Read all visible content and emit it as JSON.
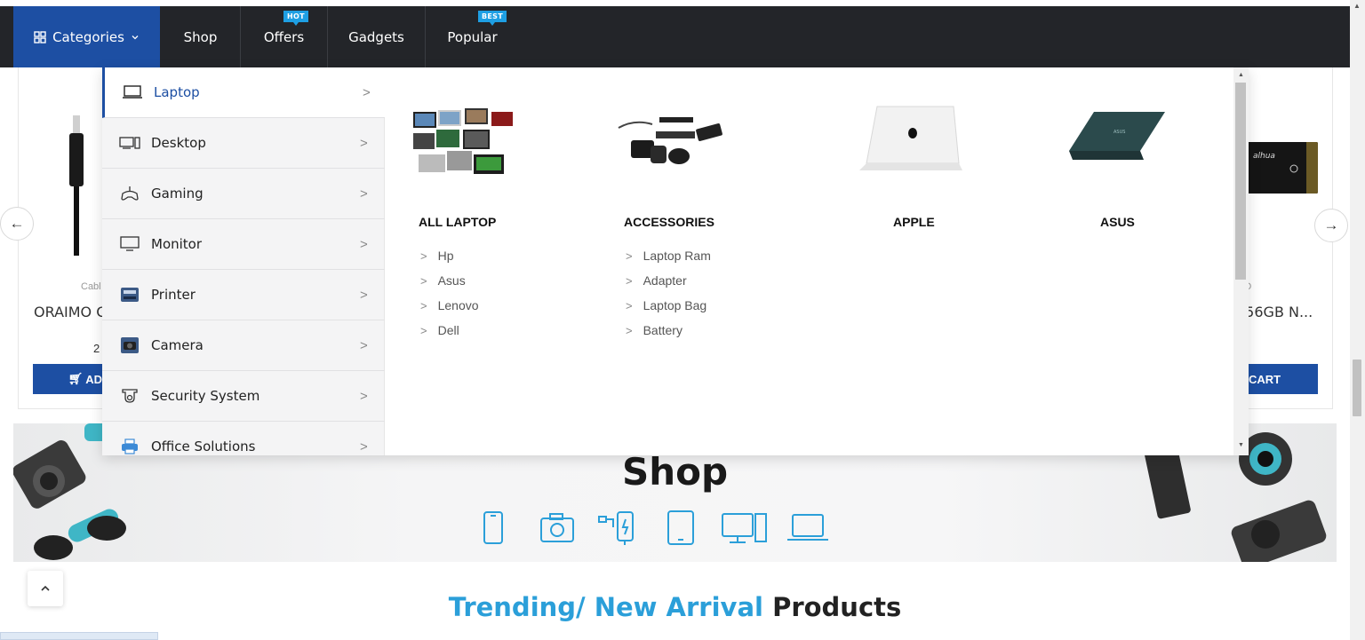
{
  "nav": {
    "categories_label": "Categories",
    "items": [
      {
        "label": "Shop",
        "badge": ""
      },
      {
        "label": "Offers",
        "badge": "HOT"
      },
      {
        "label": "Gadgets",
        "badge": ""
      },
      {
        "label": "Popular",
        "badge": "BEST"
      }
    ],
    "colors": {
      "bar": "#232529",
      "categories_bg": "#1d4fa3",
      "badge": "#1e9fe3"
    }
  },
  "dropdown": {
    "categories": [
      {
        "label": "Laptop",
        "icon": "laptop-icon",
        "active": true
      },
      {
        "label": "Desktop",
        "icon": "desktop-icon"
      },
      {
        "label": "Gaming",
        "icon": "gamepad-icon"
      },
      {
        "label": "Monitor",
        "icon": "monitor-icon"
      },
      {
        "label": "Printer",
        "icon": "printer-icon"
      },
      {
        "label": "Camera",
        "icon": "camera-icon"
      },
      {
        "label": "Security System",
        "icon": "cctv-icon"
      },
      {
        "label": "Office Solutions",
        "icon": "office-icon"
      }
    ],
    "columns": [
      {
        "title": "ALL LAPTOP",
        "items": [
          "Hp",
          "Asus",
          "Lenovo",
          "Dell"
        ]
      },
      {
        "title": "ACCESSORIES",
        "items": [
          "Laptop Ram",
          "Adapter",
          "Laptop Bag",
          "Battery"
        ]
      },
      {
        "title": "APPLE",
        "items": []
      },
      {
        "title": "ASUS",
        "items": []
      }
    ]
  },
  "products": {
    "left": {
      "category": "Cabl",
      "name": "ORAIMO C",
      "price": "2",
      "cart": "AD"
    },
    "right": {
      "category": "SD",
      "name": "256GB N...",
      "price": "৳",
      "cart": "CART"
    }
  },
  "banner": {
    "title": "Shop"
  },
  "section": {
    "title_highlight": "Trending/ New Arrival",
    "title_rest": "Products"
  },
  "accent": "#2b9fd9"
}
